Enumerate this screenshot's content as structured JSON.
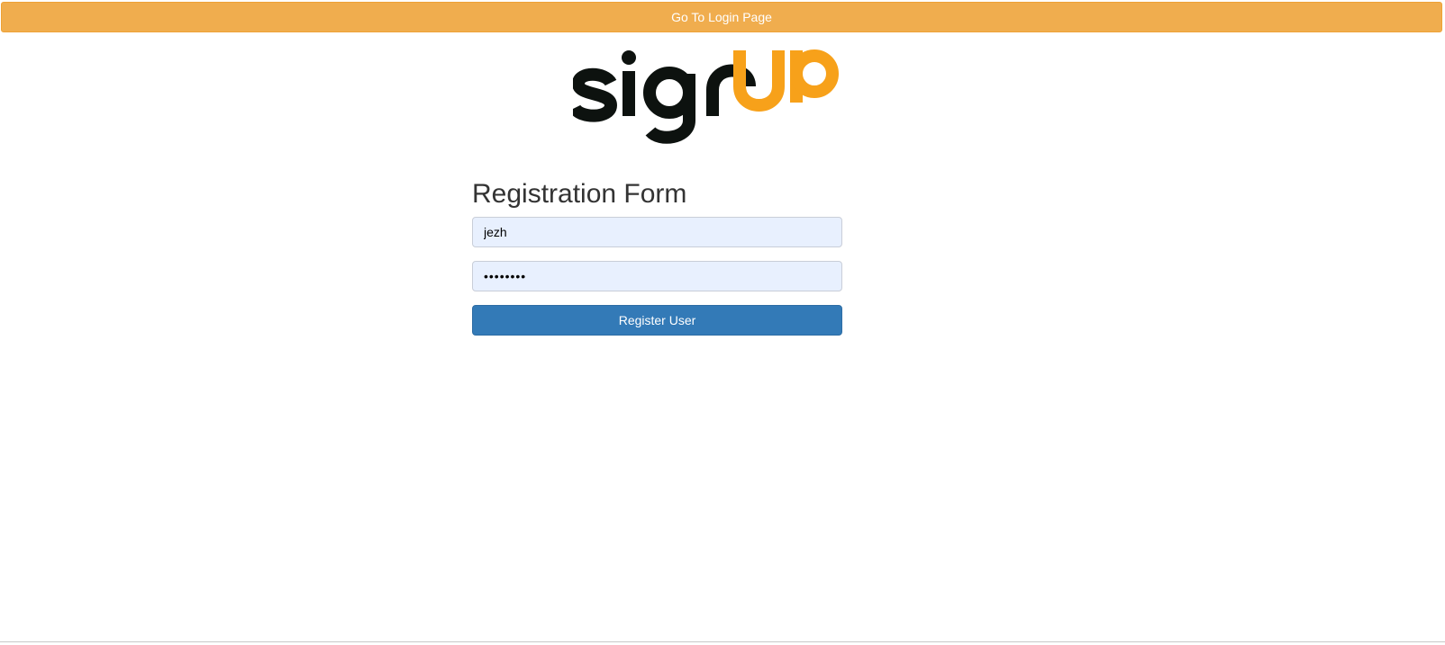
{
  "header": {
    "login_link_label": "Go To Login Page"
  },
  "logo": {
    "text": "signUP",
    "dark_color": "#0d120f",
    "accent_color": "#f7a11a"
  },
  "form": {
    "title": "Registration Form",
    "username_value": "jezh",
    "password_value": "********",
    "submit_label": "Register User"
  },
  "colors": {
    "warning_button": "#f0ad4e",
    "primary_button": "#337ab7",
    "autofill_background": "#e8f0fe"
  }
}
